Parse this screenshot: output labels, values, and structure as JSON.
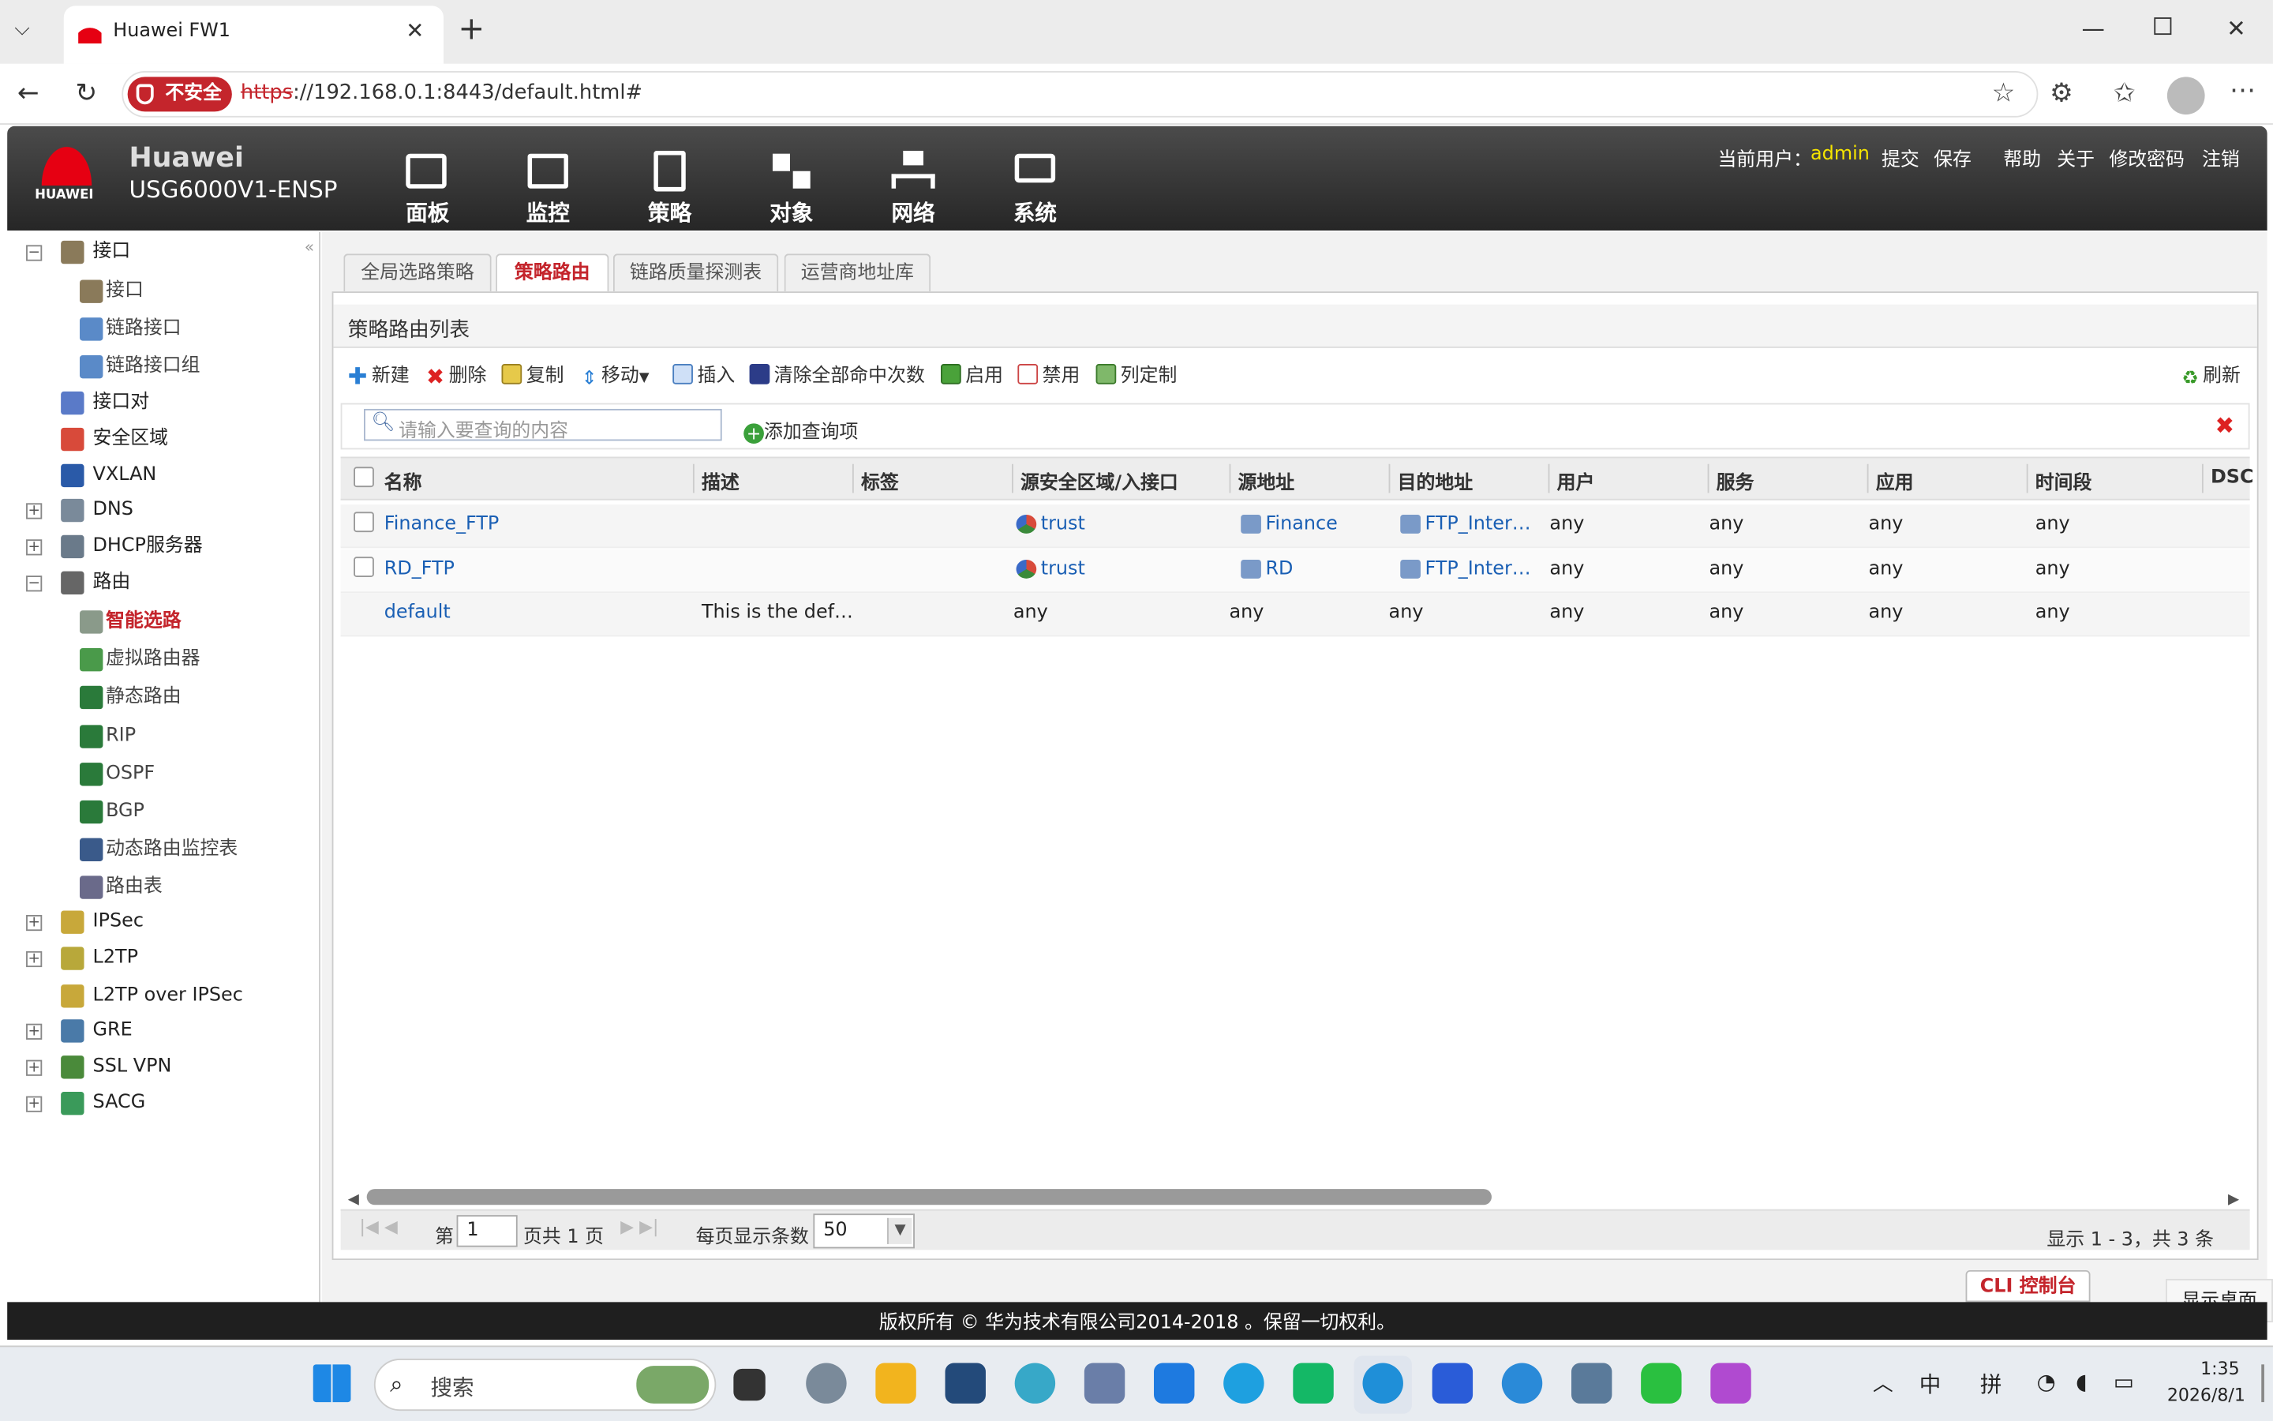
{
  "browser": {
    "tab_title": "Huawei FW1",
    "not_secure": "不安全",
    "url_scheme": "https",
    "url_rest": "://192.168.0.1:8443/default.html#"
  },
  "header": {
    "brand_line1": "Huawei",
    "brand_line2": "USG6000V1-ENSP",
    "logo_text": "HUAWEI",
    "nav": [
      "面板",
      "监控",
      "策略",
      "对象",
      "网络",
      "系统"
    ],
    "current_user_label": "当前用户：",
    "user": "admin",
    "links": [
      "提交",
      "保存",
      "帮助",
      "关于",
      "修改密码",
      "注销"
    ]
  },
  "sidebar": {
    "items": [
      {
        "label": "接口",
        "level": 0,
        "exp": "-"
      },
      {
        "label": "接口",
        "level": 1
      },
      {
        "label": "链路接口",
        "level": 1
      },
      {
        "label": "链路接口组",
        "level": 1
      },
      {
        "label": "接口对",
        "level": 0
      },
      {
        "label": "安全区域",
        "level": 0
      },
      {
        "label": "VXLAN",
        "level": 0
      },
      {
        "label": "DNS",
        "level": 0,
        "exp": "+"
      },
      {
        "label": "DHCP服务器",
        "level": 0,
        "exp": "+"
      },
      {
        "label": "路由",
        "level": 0,
        "exp": "-"
      },
      {
        "label": "智能选路",
        "level": 1,
        "selected": true
      },
      {
        "label": "虚拟路由器",
        "level": 1
      },
      {
        "label": "静态路由",
        "level": 1
      },
      {
        "label": "RIP",
        "level": 1
      },
      {
        "label": "OSPF",
        "level": 1
      },
      {
        "label": "BGP",
        "level": 1
      },
      {
        "label": "动态路由监控表",
        "level": 1
      },
      {
        "label": "路由表",
        "level": 1
      },
      {
        "label": "IPSec",
        "level": 0,
        "exp": "+"
      },
      {
        "label": "L2TP",
        "level": 0,
        "exp": "+"
      },
      {
        "label": "L2TP over IPSec",
        "level": 0
      },
      {
        "label": "GRE",
        "level": 0,
        "exp": "+"
      },
      {
        "label": "SSL VPN",
        "level": 0,
        "exp": "+"
      },
      {
        "label": "SACG",
        "level": 0,
        "exp": "+"
      }
    ]
  },
  "tabs": [
    "全局选路策略",
    "策略路由",
    "链路质量探测表",
    "运营商地址库"
  ],
  "panel": {
    "title": "策略路由列表",
    "toolbar": [
      "新建",
      "删除",
      "复制",
      "移动",
      "插入",
      "清除全部命中次数",
      "启用",
      "禁用",
      "列定制"
    ],
    "refresh": "刷新",
    "search_placeholder": "请输入要查询的内容",
    "add_query": "添加查询项"
  },
  "table": {
    "headers": [
      "名称",
      "描述",
      "标签",
      "源安全区域/入接口",
      "源地址",
      "目的地址",
      "用户",
      "服务",
      "应用",
      "时间段",
      "DSC"
    ],
    "rows": [
      {
        "name": "Finance_FTP",
        "desc": "",
        "tag": "",
        "zone": "trust",
        "src": "Finance",
        "dst": "FTP_Inter…",
        "user": "any",
        "svc": "any",
        "app": "any",
        "time": "any",
        "check": true
      },
      {
        "name": "RD_FTP",
        "desc": "",
        "tag": "",
        "zone": "trust",
        "src": "RD",
        "dst": "FTP_Inter…",
        "user": "any",
        "svc": "any",
        "app": "any",
        "time": "any",
        "check": true
      },
      {
        "name": "default",
        "desc": "This is the def…",
        "tag": "",
        "zone": "any",
        "src": "any",
        "dst": "any",
        "user": "any",
        "svc": "any",
        "app": "any",
        "time": "any",
        "check": false
      }
    ]
  },
  "pager": {
    "page_prefix": "第",
    "page": "1",
    "page_suffix": "页共 1 页",
    "per_page_label": "每页显示条数",
    "per_page": "50",
    "summary": "显示 1 - 3，共 3 条"
  },
  "cli_button": "CLI 控制台",
  "show_desktop": "显示桌面",
  "footer": "版权所有 © 华为技术有限公司2014-2018 。保留一切权利。",
  "taskbar": {
    "search": "搜索",
    "ime1": "中",
    "ime2": "拼",
    "time": "1:35",
    "date": "2026/8/1"
  }
}
